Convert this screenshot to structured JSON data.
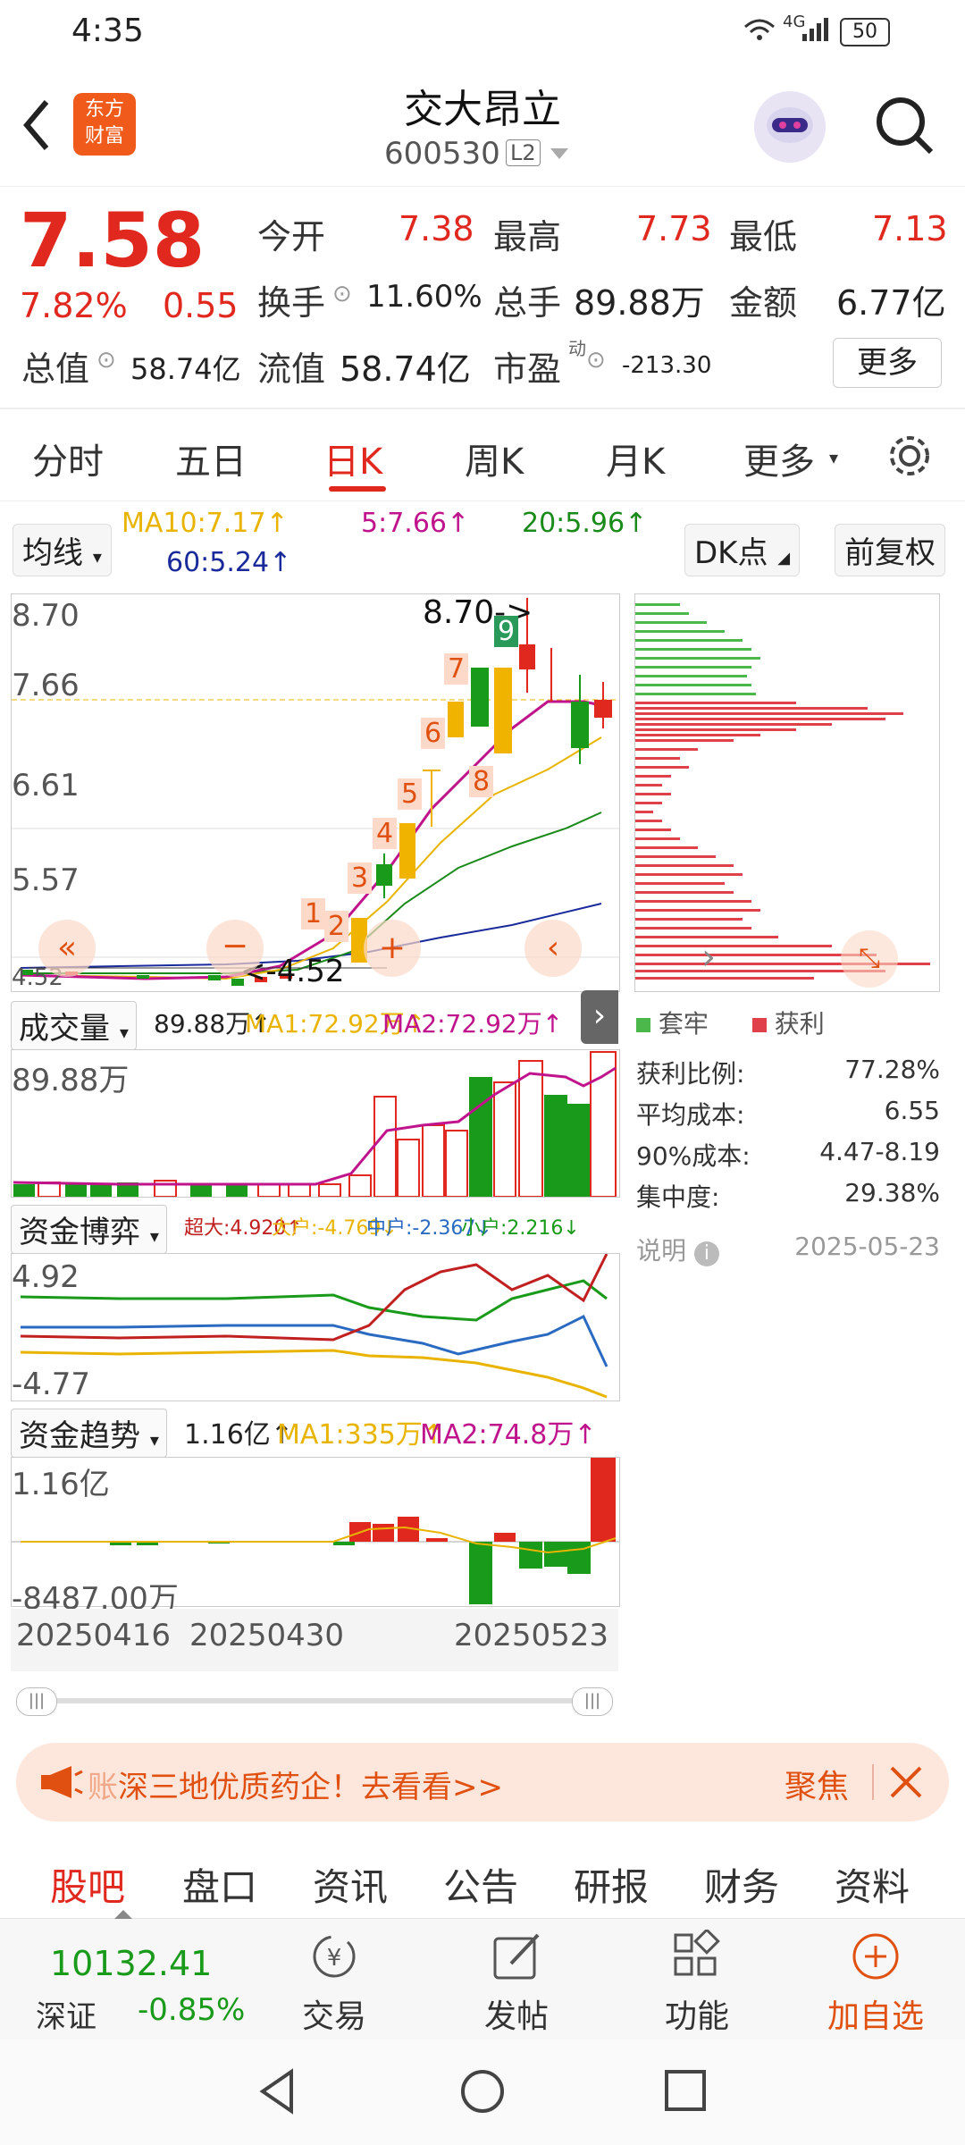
{
  "status_bar": {
    "time": "4:35",
    "network": "4G",
    "battery": "50"
  },
  "header": {
    "title": "交大昂立",
    "code": "600530",
    "level_badge": "L2",
    "logo_line1": "东方",
    "logo_line2": "财富"
  },
  "quote": {
    "price": "7.58",
    "change_pct": "7.82%",
    "change_abs": "0.55",
    "rows": [
      [
        {
          "label": "今开",
          "value": "7.38"
        },
        {
          "label": "最高",
          "value": "7.73"
        },
        {
          "label": "最低",
          "value": "7.13"
        }
      ],
      [
        {
          "label": "换手",
          "value": "11.60%"
        },
        {
          "label": "总手",
          "value": "89.88万"
        },
        {
          "label": "金额",
          "value": "6.77亿"
        }
      ]
    ],
    "total_value_label": "总值",
    "total_value": "58.74亿",
    "float_label": "流值",
    "float_value": "58.74亿",
    "pe_label": "市盈",
    "pe_sup": "动",
    "pe_value": "-213.30",
    "more_label": "更多"
  },
  "tabs": [
    "分时",
    "五日",
    "日K",
    "周K",
    "月K",
    "更多"
  ],
  "active_tab": "日K",
  "ma_bar": {
    "type_label": "均线",
    "ma10": "MA10:7.17↑",
    "ma5": "5:7.66↑",
    "ma20": "20:5.96↑",
    "ma60": "60:5.24↑",
    "dk_label": "DK点",
    "fq_label": "前复权"
  },
  "kline": {
    "y_ticks": [
      "8.70",
      "7.66",
      "6.61",
      "5.57",
      "4.52"
    ],
    "high_mark": "8.70->",
    "low_mark": "<-4.52",
    "dk_numbers": [
      "1",
      "2",
      "3",
      "4",
      "5",
      "6",
      "7",
      "8",
      "9"
    ]
  },
  "volume": {
    "label": "成交量",
    "value": "89.88万↑",
    "ma1": "MA1:72.92万↑",
    "ma2": "MA2:72.92万↑",
    "y_top": "89.88万"
  },
  "fund_game": {
    "label": "资金博弈",
    "super": "超大:4.920↑",
    "big": "大户:-4.769↓",
    "mid": "中户:-2.367↓",
    "small": "小户:2.216↓",
    "y_top": "4.92",
    "y_bottom": "-4.77"
  },
  "fund_trend": {
    "label": "资金趋势",
    "value": "1.16亿↑",
    "ma1": "MA1:335万↑",
    "ma2": "MA2:74.8万↑",
    "y_top": "1.16亿",
    "y_bottom": "-8487.00万"
  },
  "dates": [
    "20250416",
    "20250430",
    "20250523"
  ],
  "chips": {
    "legend_trapped": "套牢",
    "legend_profit": "获利",
    "stats": [
      {
        "label": "获利比例:",
        "value": "77.28%"
      },
      {
        "label": "平均成本:",
        "value": "6.55"
      },
      {
        "label": "90%成本:",
        "value": "4.47-8.19"
      },
      {
        "label": "集中度:",
        "value": "29.38%"
      }
    ],
    "note_label": "说明",
    "date": "2025-05-23"
  },
  "banner": {
    "text": "深三地优质药企！去看看>>",
    "prefix": "账",
    "tag": "聚焦"
  },
  "bottom_tabs": [
    "股吧",
    "盘口",
    "资讯",
    "公告",
    "研报",
    "财务",
    "资料"
  ],
  "bottom_bar": {
    "index_value": "10132.41",
    "index_name": "深证",
    "index_change": "-0.85%",
    "trade": "交易",
    "post": "发帖",
    "func": "功能",
    "add": "加自选"
  },
  "colors": {
    "up": "#e0281e",
    "down": "#1a9a1a",
    "ma5": "#c0148c",
    "ma10": "#e8b400",
    "ma20": "#1a8a1a",
    "ma60": "#1a2a9a"
  }
}
